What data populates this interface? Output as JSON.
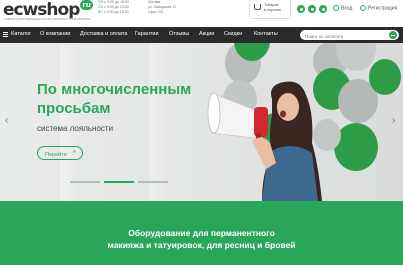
{
  "header": {
    "logo_text": "ecwshop",
    "logo_badge": "ru",
    "logo_tagline": "ТОВАРЫ ДЛЯ ПЕРМАНЕНТНОГО МАКИЯЖА И ТАТУИРОВОК",
    "hours": [
      {
        "day": "ПН",
        "time": "с 9:00 до 18:00"
      },
      {
        "day": "СБ",
        "time": "с 9:00 до 15:00"
      },
      {
        "day": "ВС",
        "time": "с 9:00 до 18:00"
      }
    ],
    "address_lines": [
      "Москва",
      "ул. Заводская 11,",
      "офис 201"
    ],
    "cart_lines": [
      "Товаров",
      "в корзине"
    ],
    "social_icons": [
      "vk-icon",
      "youtube-icon",
      "instagram-icon",
      "telegram-icon",
      "whatsapp-icon"
    ],
    "login_label": "Вход",
    "register_label": "Регистрация"
  },
  "nav": {
    "items": [
      "Каталог",
      "О компании",
      "Доставка и оплата",
      "Гарантии",
      "Отзывы",
      "Акции",
      "Скидки",
      "Контакты"
    ],
    "search_placeholder": "Поиск по каталогу"
  },
  "banner": {
    "headline_line1": "По многочисленным",
    "headline_line2": "просьбам",
    "subtitle": "система лояльности",
    "button_label": "Перейти",
    "button_chevron": "»",
    "prev_arrow": "‹",
    "next_arrow": "›",
    "slide_count": 3,
    "active_slide": 2
  },
  "promo": {
    "title_line1": "Оборудование для перманентного",
    "title_line2": "макияжа и татуировок, для ресниц и бровей"
  },
  "colors": {
    "accent": "#2aa65a",
    "nav_bg": "#2b2b2b",
    "balloon_green": "#2e9c47",
    "balloon_silver": "#b9bdbb"
  }
}
